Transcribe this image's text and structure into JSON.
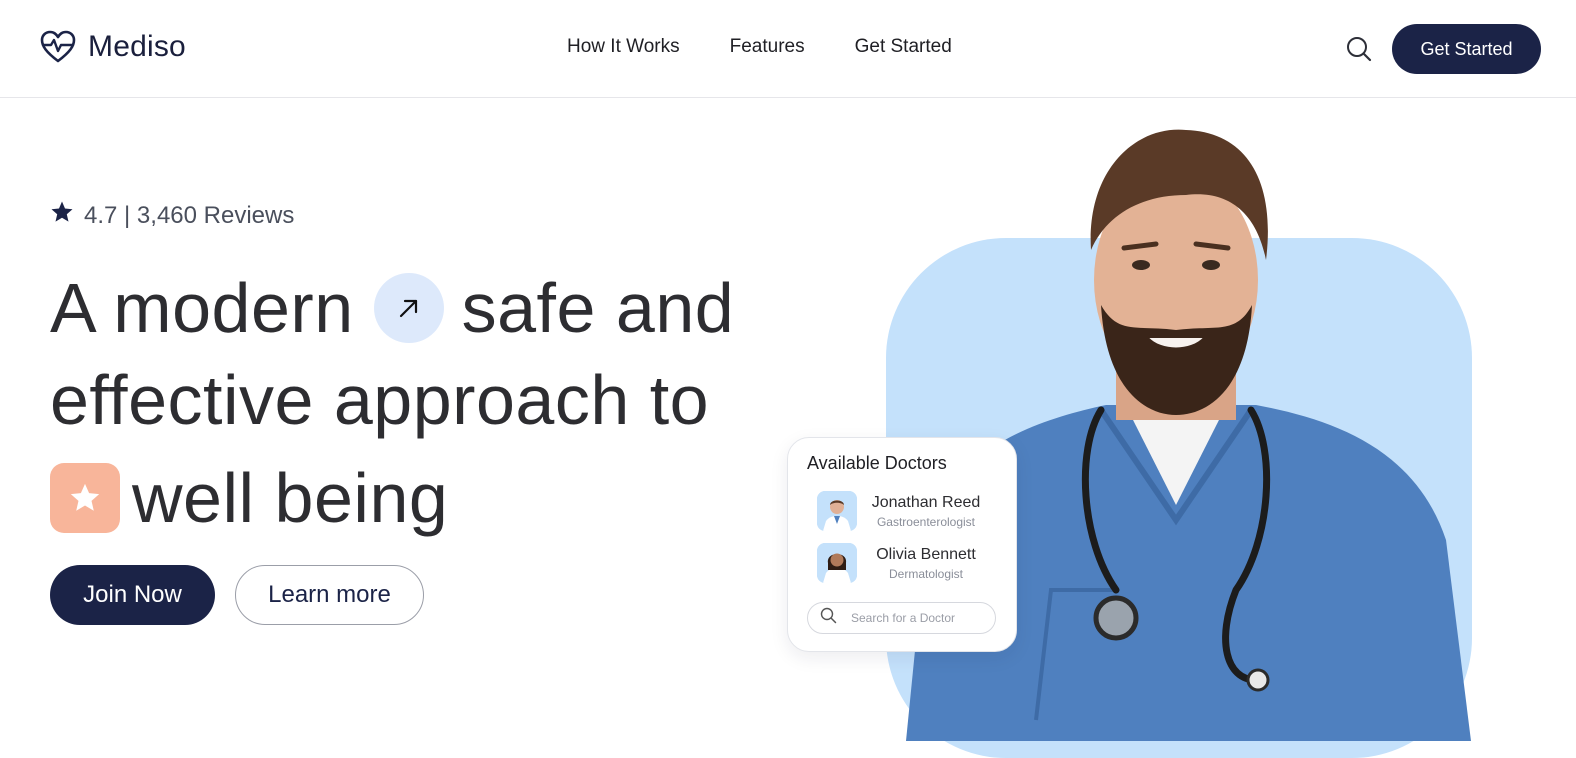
{
  "brand": {
    "name": "Mediso",
    "logo_icon": "heart-pulse-icon",
    "color": "#1b2347"
  },
  "nav": {
    "items": [
      {
        "label": "How It Works"
      },
      {
        "label": "Features"
      },
      {
        "label": "Get Started"
      }
    ]
  },
  "header": {
    "search_icon": "search-icon",
    "cta_label": "Get Started"
  },
  "hero": {
    "rating": {
      "icon": "star-icon",
      "text": "4.7 | 3,460 Reviews"
    },
    "headline": {
      "line1_a": "A modern",
      "line1_b": "safe and",
      "line2": "effective approach to",
      "line3": "well being"
    },
    "arrow_chip_icon": "arrow-up-right-icon",
    "star_chip_icon": "star-icon",
    "join_label": "Join Now",
    "learn_label": "Learn more"
  },
  "doctors_card": {
    "title": "Available Doctors",
    "doctors": [
      {
        "name": "Jonathan Reed",
        "specialty": "Gastroenterologist"
      },
      {
        "name": "Olivia Bennett",
        "specialty": "Dermatologist"
      }
    ],
    "search_placeholder": "Search for a Doctor"
  },
  "colors": {
    "accent_navy": "#1b2347",
    "panel_blue": "#c4e1fb",
    "chip_blue": "#dde9fb",
    "chip_peach": "#f8b59a"
  }
}
